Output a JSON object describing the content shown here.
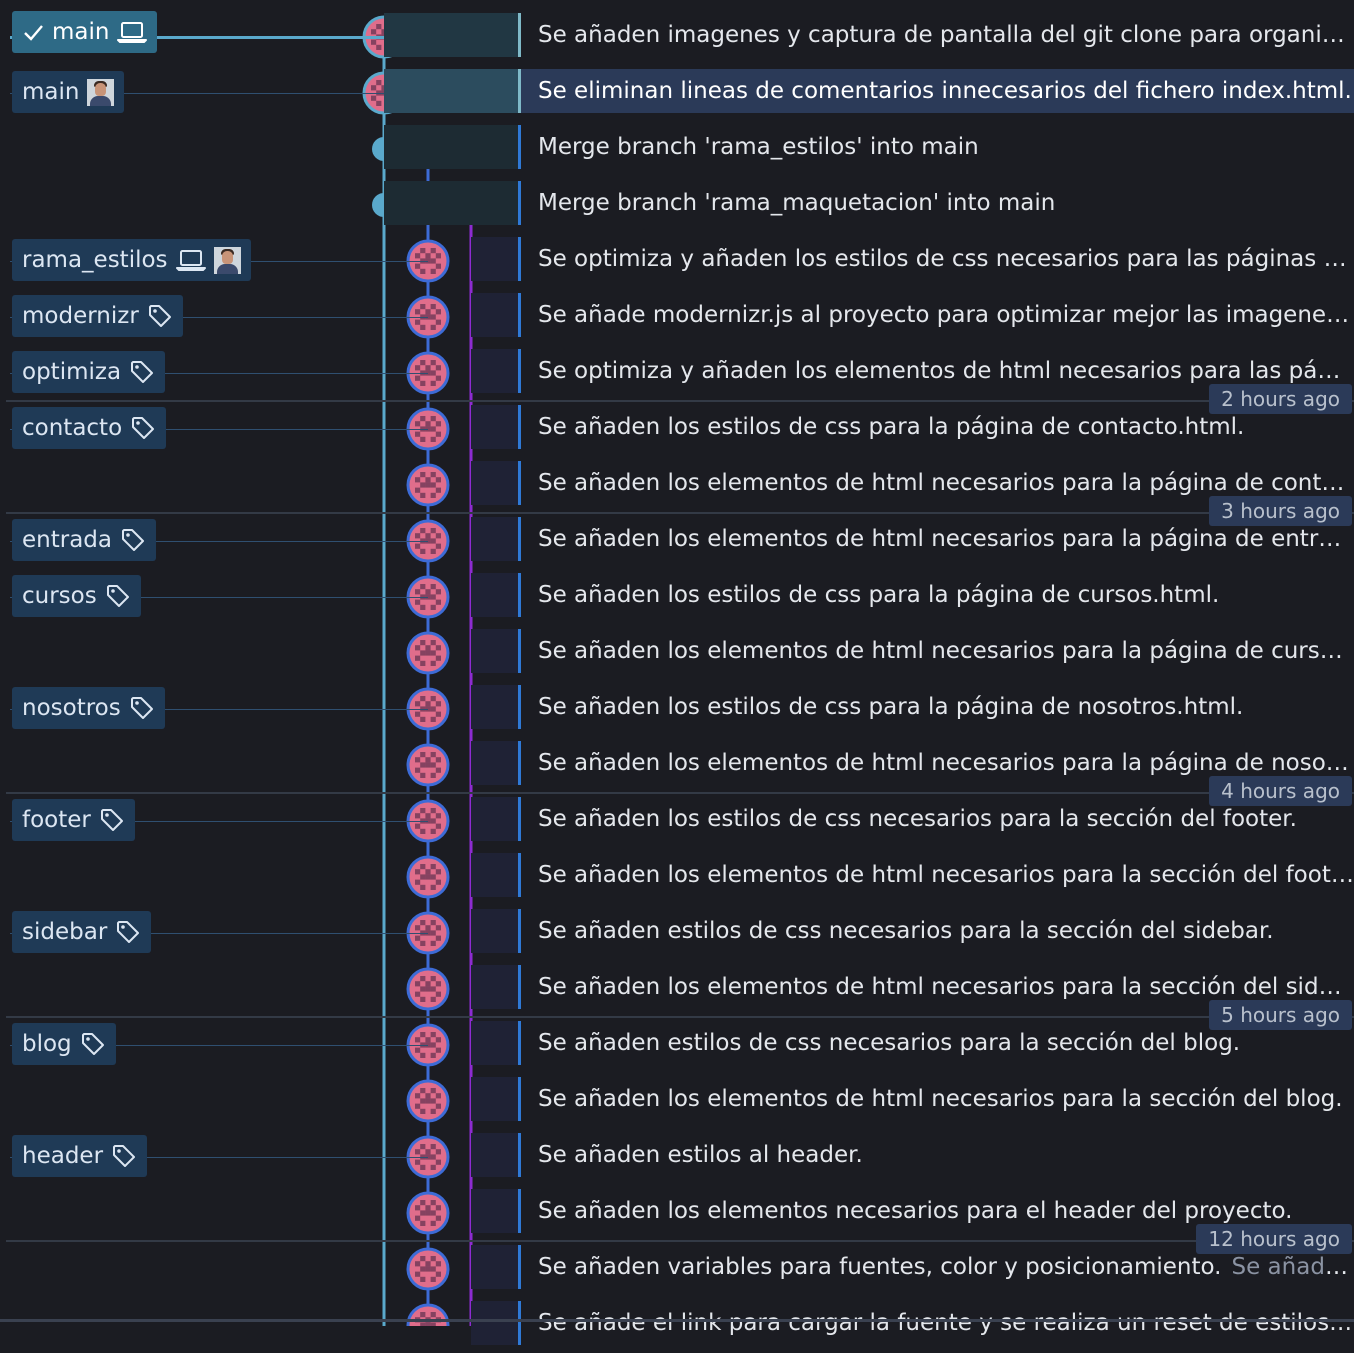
{
  "colors": {
    "lane_main": "#5aa9cc",
    "lane_branch": "#3d6bd6",
    "lane_merge": "#8d2bd1",
    "avatar_pink": "#e06d8b",
    "avatar_dark": "#3b1f3e"
  },
  "commits": [
    {
      "lane": 0,
      "node": "avatar",
      "message": "Se añaden imagenes y captura de pantalla del git clone para organizar el proyecto",
      "head": true,
      "ref": {
        "label": "main",
        "check_icon": "check-icon",
        "laptop_icon": "laptop-icon"
      }
    },
    {
      "lane": 0,
      "node": "avatar",
      "message": "Se eliminan lineas de comentarios innecesarios del fichero index.html.",
      "selected": true,
      "ref": {
        "label": "main",
        "avatar_icon": "avatar-icon"
      }
    },
    {
      "lane": 0,
      "node": "dot",
      "message": "Merge branch 'rama_estilos' into main"
    },
    {
      "lane": 0,
      "node": "dot",
      "message": "Merge branch 'rama_maquetacion' into main"
    },
    {
      "lane": 1,
      "node": "avatar",
      "message": "Se optimiza y añaden los estilos de css necesarios para las páginas de:...",
      "ref": {
        "label": "rama_estilos",
        "laptop_icon": "laptop-icon",
        "avatar_icon": "avatar-icon"
      }
    },
    {
      "lane": 1,
      "node": "avatar",
      "message": "Se añade modernizr.js al proyecto para optimizar mejor las imagenes webp",
      "ref": {
        "label": "modernizr",
        "tag_icon": "tag-icon"
      }
    },
    {
      "lane": 1,
      "node": "avatar",
      "message": "Se optimiza y añaden los elementos de html necesarios para las páginas de",
      "ref": {
        "label": "optimiza",
        "tag_icon": "tag-icon"
      }
    },
    {
      "lane": 1,
      "node": "avatar",
      "message": "Se añaden los estilos de css para la página de contacto.html.",
      "divider": true,
      "time": "2 hours ago",
      "ref": {
        "label": "contacto",
        "tag_icon": "tag-icon"
      }
    },
    {
      "lane": 1,
      "node": "avatar",
      "message": "Se añaden los elementos de html necesarios para la página de contacto.html"
    },
    {
      "lane": 1,
      "node": "avatar",
      "message": "Se añaden los elementos de html necesarios para la página de entrada.html",
      "divider": true,
      "time": "3 hours ago",
      "ref": {
        "label": "entrada",
        "tag_icon": "tag-icon"
      }
    },
    {
      "lane": 1,
      "node": "avatar",
      "message": "Se añaden los estilos de css para la página de cursos.html.",
      "ref": {
        "label": "cursos",
        "tag_icon": "tag-icon"
      }
    },
    {
      "lane": 1,
      "node": "avatar",
      "message": "Se añaden los elementos de html necesarios para la página de cursos.html"
    },
    {
      "lane": 1,
      "node": "avatar",
      "message": "Se añaden los estilos de css para la página de nosotros.html.",
      "ref": {
        "label": "nosotros",
        "tag_icon": "tag-icon"
      }
    },
    {
      "lane": 1,
      "node": "avatar",
      "message": "Se añaden los elementos de html necesarios para la página de nosotros.html"
    },
    {
      "lane": 1,
      "node": "avatar",
      "message": "Se añaden los estilos de css necesarios para la sección del footer.",
      "divider": true,
      "time": "4 hours ago",
      "ref": {
        "label": "footer",
        "tag_icon": "tag-icon"
      }
    },
    {
      "lane": 1,
      "node": "avatar",
      "message": "Se añaden los elementos de html necesarios para la sección del footer."
    },
    {
      "lane": 1,
      "node": "avatar",
      "message": "Se añaden estilos de css necesarios para la sección del sidebar.",
      "ref": {
        "label": "sidebar",
        "tag_icon": "tag-icon"
      }
    },
    {
      "lane": 1,
      "node": "avatar",
      "message": "Se añaden los elementos de html necesarios para la sección del sidebar."
    },
    {
      "lane": 1,
      "node": "avatar",
      "message": "Se añaden estilos de css necesarios para la sección del blog.",
      "divider": true,
      "time": "5 hours ago",
      "ref": {
        "label": "blog",
        "tag_icon": "tag-icon"
      }
    },
    {
      "lane": 1,
      "node": "avatar",
      "message": "Se añaden los elementos de html necesarios para la sección del blog."
    },
    {
      "lane": 1,
      "node": "avatar",
      "message": "Se añaden estilos al header.",
      "ref": {
        "label": "header",
        "tag_icon": "tag-icon"
      }
    },
    {
      "lane": 1,
      "node": "avatar",
      "message": "Se añaden los elementos necesarios para el header del proyecto."
    },
    {
      "lane": 1,
      "node": "avatar",
      "message": "Se añaden variables para fuentes, color y posicionamiento.",
      "extra": "Se añaden ...",
      "divider": true,
      "time": "12 hours ago"
    },
    {
      "lane": 1,
      "node": "avatar",
      "message": "Se añade el link para cargar la fuente y se realiza un reset de estilos del documento"
    }
  ]
}
